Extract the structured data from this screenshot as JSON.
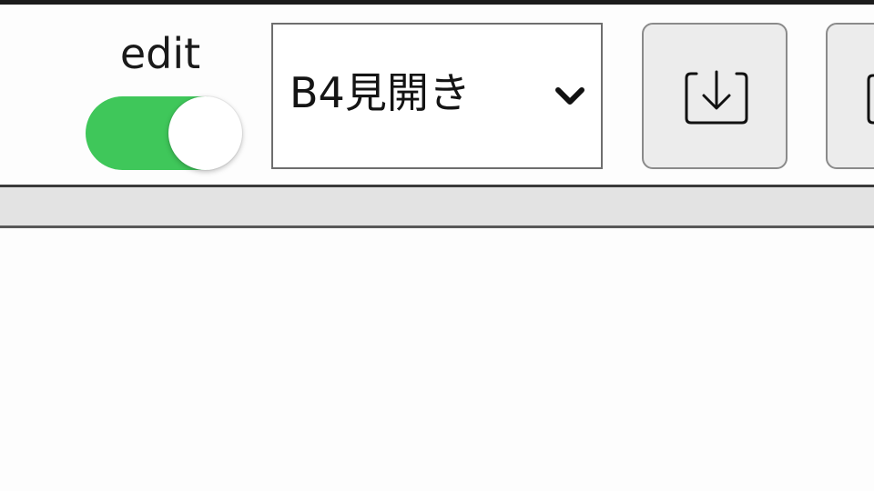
{
  "toolbar": {
    "edit_label": "edit",
    "edit_toggle": {
      "on": true,
      "color": "#3fc75a"
    },
    "paper_size": {
      "selected": "B4見開き"
    },
    "buttons": [
      {
        "icon": "download-icon"
      },
      {
        "icon": "unknown-icon"
      }
    ]
  },
  "colors": {
    "toggle_on": "#3fc75a",
    "button_bg": "#ececec",
    "strip_bg": "#e3e3e3"
  }
}
